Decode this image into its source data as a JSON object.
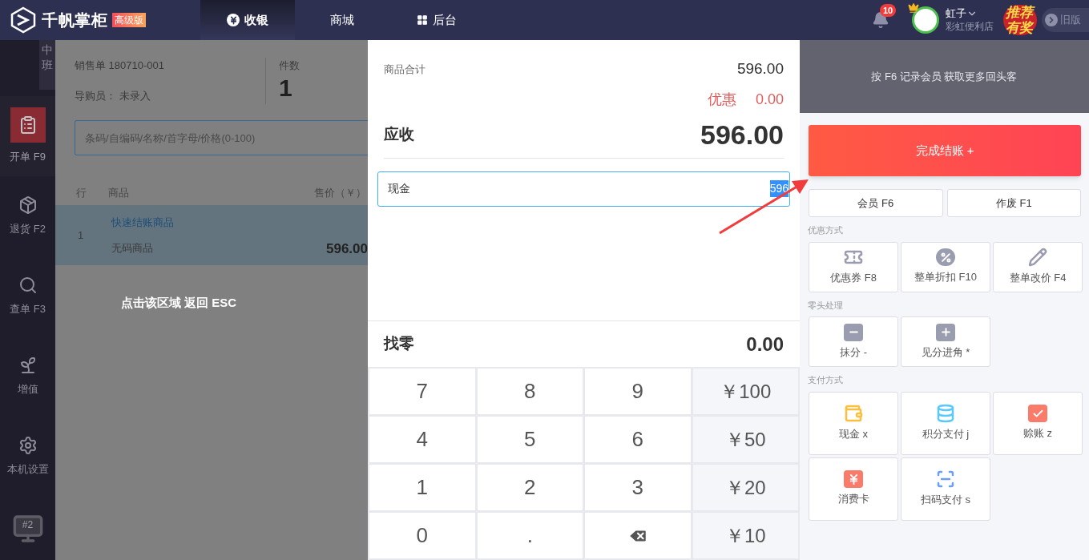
{
  "header": {
    "brand": "千帆掌柜",
    "edition": "高级版",
    "tabs": [
      {
        "label": "收银",
        "kind": "yen",
        "selected": true
      },
      {
        "label": "商城",
        "kind": "plain",
        "selected": false
      },
      {
        "label": "后台",
        "kind": "grid",
        "selected": false
      }
    ],
    "notifications": "10",
    "user": {
      "name": "虹子",
      "store": "彩虹便利店"
    },
    "promo": "推荐有奖",
    "old_version": "旧版"
  },
  "sidebar": {
    "shift": "中班",
    "items": [
      {
        "label": "开单 F9",
        "kind": "order",
        "selected": true
      },
      {
        "label": "退货 F2",
        "kind": "return",
        "selected": false
      },
      {
        "label": "查单 F3",
        "kind": "search",
        "selected": false
      },
      {
        "label": "增值",
        "kind": "grow",
        "selected": false
      },
      {
        "label": "本机设置",
        "kind": "settings",
        "selected": false
      }
    ],
    "terminal": "#2"
  },
  "order": {
    "number_label": "销售单 180710-001",
    "guide_label": "导购员： 未录入",
    "count_label": "件数",
    "count": "1",
    "search": {
      "placeholder": "条码/自编码/名称/首字母/价格(0-100)"
    },
    "columns": [
      "行",
      "商品",
      "售价（￥）"
    ],
    "rows": [
      {
        "index": "1",
        "name": "快速结账商品",
        "code": "无码商品",
        "price": "596.00",
        "selected": true
      }
    ],
    "overlay_hint": "点击该区域 返回 ESC"
  },
  "checkout": {
    "subtotal_label": "商品合计",
    "subtotal": "596.00",
    "discount_label": "优惠",
    "discount": "0.00",
    "due_label": "应收",
    "due": "596.00",
    "payment": {
      "label": "现金",
      "value": "596",
      "value_selected": true
    },
    "change_label": "找零",
    "change": "0.00",
    "keys": [
      {
        "kind": "digit",
        "label": "7"
      },
      {
        "kind": "digit",
        "label": "8"
      },
      {
        "kind": "digit",
        "label": "9"
      },
      {
        "kind": "amount",
        "label": "￥100"
      },
      {
        "kind": "digit",
        "label": "4"
      },
      {
        "kind": "digit",
        "label": "5"
      },
      {
        "kind": "digit",
        "label": "6"
      },
      {
        "kind": "amount",
        "label": "￥50"
      },
      {
        "kind": "digit",
        "label": "1"
      },
      {
        "kind": "digit",
        "label": "2"
      },
      {
        "kind": "digit",
        "label": "3"
      },
      {
        "kind": "amount",
        "label": "￥20"
      },
      {
        "kind": "digit",
        "label": "0"
      },
      {
        "kind": "digit",
        "label": "."
      },
      {
        "kind": "backspace"
      },
      {
        "kind": "amount",
        "label": "￥10"
      }
    ]
  },
  "actions": {
    "banner": "按 F6 记录会员 获取更多回头客",
    "finish": "完成结账 +",
    "buttons": [
      "会员 F6",
      "作废 F1"
    ],
    "sections": [
      {
        "title": "优惠方式",
        "tiles": [
          {
            "kind": "coupon",
            "label": "优惠券 F8"
          },
          {
            "kind": "discount",
            "label": "整单折扣 F10"
          },
          {
            "kind": "reprice",
            "label": "整单改价 F4"
          }
        ]
      },
      {
        "title": "零头处理",
        "tiles": [
          {
            "kind": "wipe",
            "label": "抹分 -"
          },
          {
            "kind": "roundup",
            "label": "见分进角 *"
          }
        ]
      },
      {
        "title": "支付方式",
        "tiles": [
          {
            "kind": "cash",
            "label": "现金 x"
          },
          {
            "kind": "points",
            "label": "积分支付 j"
          },
          {
            "kind": "credit",
            "label": "赊账 z"
          },
          {
            "kind": "card",
            "label": "消费卡"
          },
          {
            "kind": "scan",
            "label": "扫码支付 s"
          }
        ]
      }
    ]
  }
}
